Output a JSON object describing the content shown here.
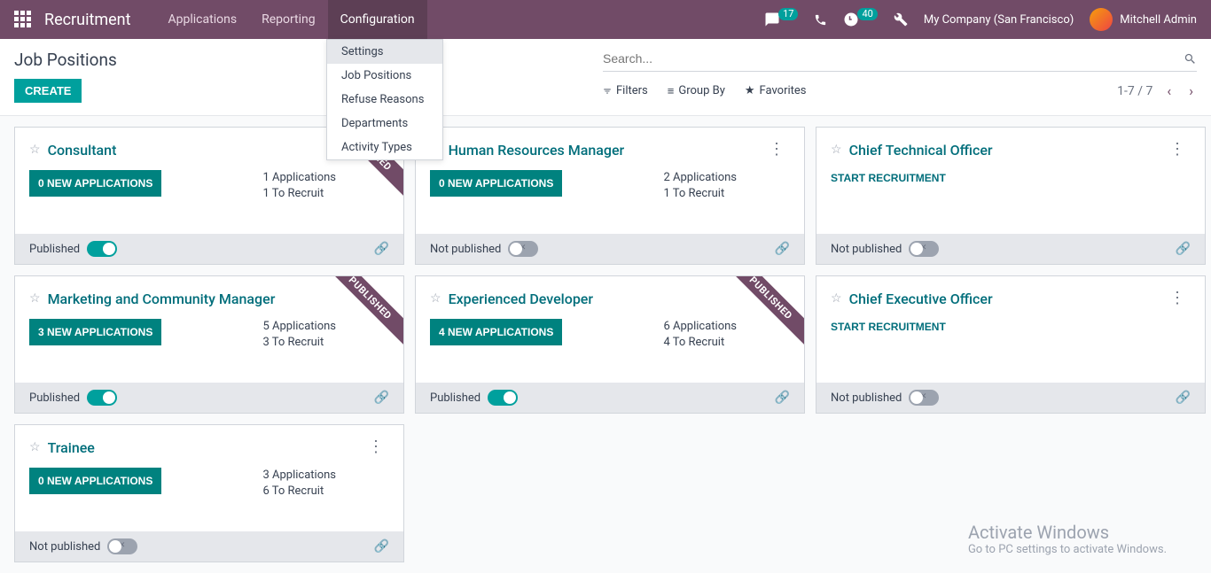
{
  "nav": {
    "brand": "Recruitment",
    "links": [
      "Applications",
      "Reporting",
      "Configuration"
    ],
    "msg_count": "17",
    "clock_count": "40",
    "company": "My Company (San Francisco)",
    "user": "Mitchell Admin"
  },
  "dropdown": [
    "Settings",
    "Job Positions",
    "Refuse Reasons",
    "Departments",
    "Activity Types"
  ],
  "page": {
    "title": "Job Positions",
    "create": "CREATE",
    "search_ph": "Search...",
    "filters": "Filters",
    "group_by": "Group By",
    "favorites": "Favorites",
    "pager": "1-7 / 7"
  },
  "labels": {
    "published": "Published",
    "not_published": "Not published",
    "ribbon": "PUBLISHED"
  },
  "cards": [
    {
      "title": "Consultant",
      "btn": "0 NEW APPLICATIONS",
      "s1": "1 Applications",
      "s2": "1 To Recruit",
      "pub": true,
      "ribbon": true,
      "start": false
    },
    {
      "title": "Human Resources Manager",
      "btn": "0 NEW APPLICATIONS",
      "s1": "2 Applications",
      "s2": "1 To Recruit",
      "pub": false,
      "ribbon": false,
      "start": false
    },
    {
      "title": "Chief Technical Officer",
      "btn": "START RECRUITMENT",
      "s1": "",
      "s2": "",
      "pub": false,
      "ribbon": false,
      "start": true
    },
    {
      "title": "Marketing and Community Manager",
      "btn": "3 NEW APPLICATIONS",
      "s1": "5 Applications",
      "s2": "3 To Recruit",
      "pub": true,
      "ribbon": true,
      "start": false
    },
    {
      "title": "Experienced Developer",
      "btn": "4 NEW APPLICATIONS",
      "s1": "6 Applications",
      "s2": "4 To Recruit",
      "pub": true,
      "ribbon": true,
      "start": false
    },
    {
      "title": "Chief Executive Officer",
      "btn": "START RECRUITMENT",
      "s1": "",
      "s2": "",
      "pub": false,
      "ribbon": false,
      "start": true
    },
    {
      "title": "Trainee",
      "btn": "0 NEW APPLICATIONS",
      "s1": "3 Applications",
      "s2": "6 To Recruit",
      "pub": false,
      "ribbon": false,
      "start": false
    }
  ],
  "wm": {
    "t": "Activate Windows",
    "s": "Go to PC settings to activate Windows."
  }
}
